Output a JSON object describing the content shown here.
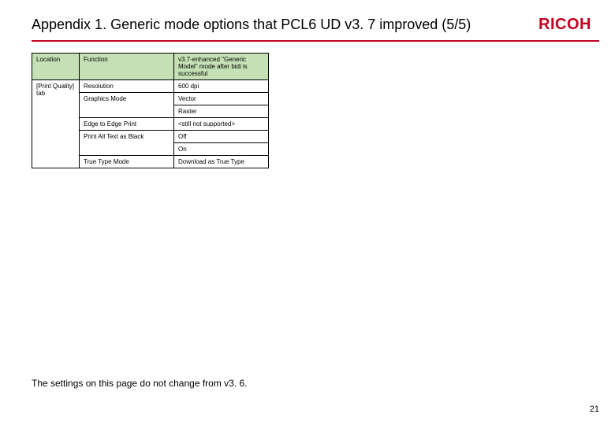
{
  "header": {
    "title": "Appendix 1. Generic mode options that PCL6 UD v3. 7 improved (5/5)",
    "logo": "RICOH"
  },
  "table": {
    "headers": {
      "c0": "Location",
      "c1": "Function",
      "c2": "v3.7-enhanced \"Generic Model\" mode after bidi is successful"
    },
    "rows": {
      "r0": {
        "loc": "[Print Quality] tab",
        "func": "Resolution",
        "val": "600 dpi"
      },
      "r1": {
        "func": "Graphics Mode",
        "val": "Vector"
      },
      "r2": {
        "val": "Raster"
      },
      "r3": {
        "func": "Edge to Edge Print",
        "val": "<still not supported>"
      },
      "r4": {
        "func": "Print All Text as Black",
        "val": "Off"
      },
      "r5": {
        "val": "On"
      },
      "r6": {
        "func": "True Type Mode",
        "val": "Download as True Type"
      }
    }
  },
  "footer": {
    "note": "The settings on this page do not change from v3. 6.",
    "page": "21"
  }
}
